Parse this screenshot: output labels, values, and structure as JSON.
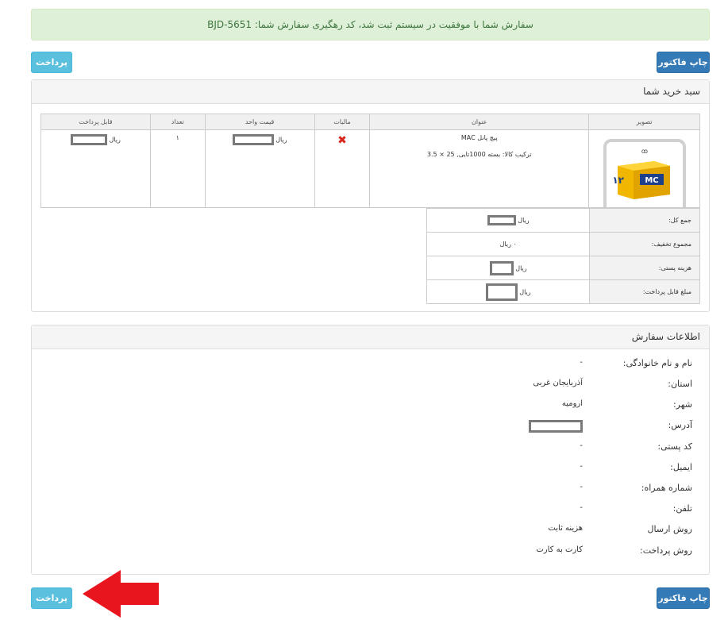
{
  "alert": {
    "message": "سفارش شما با موفقیت در سیستم ثبت شد، کد رهگیری سفارش شما: BJD-5651"
  },
  "buttons": {
    "print": "چاپ فاکتور",
    "pay": "پرداخت"
  },
  "cart": {
    "title": "سبد خرید شما",
    "headers": {
      "image": "تصویر",
      "title": "عنوان",
      "tax": "مالیات",
      "unit_price": "قیمت واحد",
      "qty": "تعداد",
      "payable": "قابل پرداخت"
    },
    "item": {
      "name": "پیچ پانل MAC",
      "composition": "ترکیب کالا: بسته 1000تایی, 25 × 3.5",
      "qty": "۱",
      "currency": "ریال",
      "tax_icon": "x-icon",
      "product_image_text": "MC"
    },
    "totals": [
      {
        "label": "جمع کل:",
        "value": "ریال"
      },
      {
        "label": "مجموع تخفیف:",
        "value": "۰ ریال"
      },
      {
        "label": "هزینه پستی:",
        "value": "ریال"
      },
      {
        "label": "مبلغ قابل پرداخت:",
        "value": "ریال"
      }
    ]
  },
  "order": {
    "title": "اطلاعات سفارش",
    "rows": [
      {
        "label": "نام و نام خانوادگی:",
        "value": "-"
      },
      {
        "label": "استان:",
        "value": "آذربایجان غربی"
      },
      {
        "label": "شهر:",
        "value": "ارومیه"
      },
      {
        "label": "آدرس:",
        "value": ""
      },
      {
        "label": "کد پستی:",
        "value": "-"
      },
      {
        "label": "ایمیل:",
        "value": "-"
      },
      {
        "label": "شماره همراه:",
        "value": "-"
      },
      {
        "label": "تلفن:",
        "value": "-"
      },
      {
        "label": "روش ارسال",
        "value": "هزینه ثابت"
      },
      {
        "label": "روش پرداخت:",
        "value": "کارت به کارت"
      }
    ]
  },
  "colors": {
    "primary": "#337ab7",
    "info": "#5bc0de",
    "success_bg": "#dff0d8",
    "arrow": "#e8151e"
  }
}
